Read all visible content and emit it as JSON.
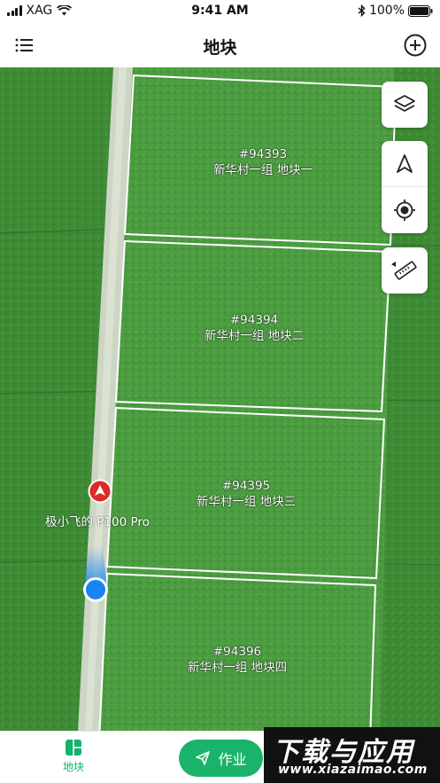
{
  "status_bar": {
    "carrier": "XAG",
    "time": "9:41 AM",
    "battery": "100%"
  },
  "nav": {
    "title": "地块",
    "menu_icon": "list-menu-icon",
    "add_icon": "plus-circle-icon"
  },
  "plots": [
    {
      "id": "#94393",
      "name": "新华村一组 地块一"
    },
    {
      "id": "#94394",
      "name": "新华村一组 地块二"
    },
    {
      "id": "#94395",
      "name": "新华村一组 地块三"
    },
    {
      "id": "#94396",
      "name": "新华村一组 地块四"
    }
  ],
  "map_controls": [
    {
      "icon": "layers-icon"
    },
    {
      "icon": "navigation-arrow-icon"
    },
    {
      "icon": "locate-target-icon"
    },
    {
      "icon": "ruler-icon"
    }
  ],
  "drone": {
    "label": "极小飞的 P100 Pro"
  },
  "tab_bar": {
    "plot_tab_label": "地块",
    "work_button_label": "作业"
  },
  "watermark": {
    "title": "下载与应用",
    "url": "www.xiazaimao.com"
  },
  "colors": {
    "accent": "#17b26a",
    "field": "#4a9a3f",
    "road": "#cfd6c8",
    "location_blue": "#1a84f0",
    "drone_red": "#e02a2a"
  }
}
